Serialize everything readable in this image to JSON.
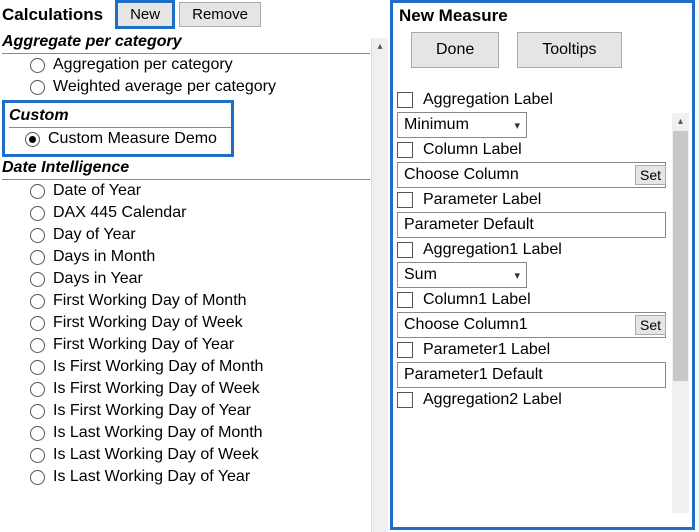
{
  "left": {
    "title": "Calculations",
    "new_btn": "New",
    "remove_btn": "Remove",
    "group_aggregate": "Aggregate per category",
    "agg_items": [
      "Aggregation per category",
      "Weighted average per category"
    ],
    "group_custom": "Custom",
    "custom_item": "Custom Measure Demo",
    "group_date": "Date Intelligence",
    "date_items": [
      "Date of Year",
      "DAX 445 Calendar",
      "Day of Year",
      "Days in Month",
      "Days in Year",
      "First Working Day of Month",
      "First Working Day of Week",
      "First Working Day of Year",
      "Is First Working Day of Month",
      "Is First Working Day of Week",
      "Is First Working Day of Year",
      "Is Last Working Day of Month",
      "Is Last Working Day of Week",
      "Is Last Working Day of Year"
    ]
  },
  "right": {
    "title": "New Measure",
    "done_btn": "Done",
    "tooltips_btn": "Tooltips",
    "rows": {
      "agg_label": "Aggregation Label",
      "agg_dd": "Minimum",
      "col_label": "Column Label",
      "choose_col": "Choose Column",
      "set": "Set",
      "param_label": "Parameter Label",
      "param_default": "Parameter Default",
      "agg1_label": "Aggregation1 Label",
      "agg1_dd": "Sum",
      "col1_label": "Column1 Label",
      "choose_col1": "Choose Column1",
      "param1_label": "Parameter1 Label",
      "param1_default": "Parameter1 Default",
      "agg2_label": "Aggregation2 Label"
    }
  }
}
